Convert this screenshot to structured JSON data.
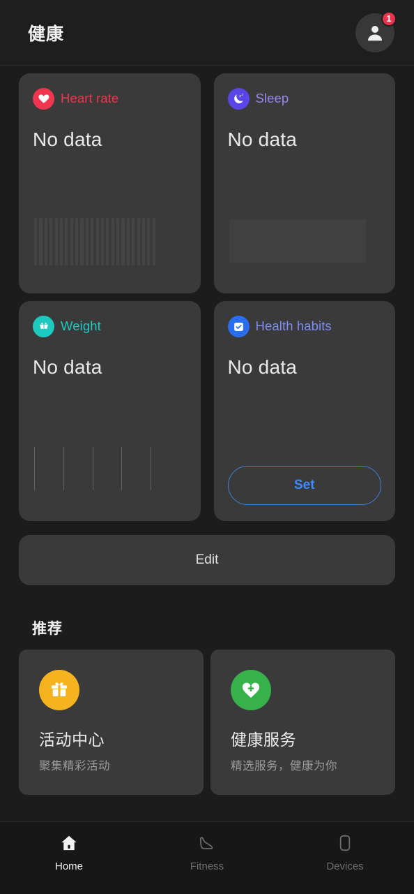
{
  "header": {
    "title": "健康",
    "avatar_icon": "person-icon",
    "badge_count": "1"
  },
  "metrics": [
    {
      "id": "heart-rate",
      "title": "Heart rate",
      "value": "No data",
      "icon": "heart-icon",
      "icon_bg": "#f0364f",
      "title_color": "#f0364f",
      "art": "bars"
    },
    {
      "id": "sleep",
      "title": "Sleep",
      "value": "No data",
      "icon": "moon-zzz-icon",
      "icon_bg": "#5a46e6",
      "title_color": "#9b87f0",
      "art": "block"
    },
    {
      "id": "weight",
      "title": "Weight",
      "value": "No data",
      "icon": "scale-icon",
      "icon_bg": "#1ecac0",
      "title_color": "#1ecac0",
      "art": "ticks"
    },
    {
      "id": "health-habits",
      "title": "Health habits",
      "value": "No data",
      "icon": "calendar-check-icon",
      "icon_bg": "#2a6ef0",
      "title_color": "#7e8ef5",
      "art": "set-button",
      "action_label": "Set"
    }
  ],
  "edit": {
    "label": "Edit"
  },
  "recommend": {
    "section_title": "推荐",
    "cards": [
      {
        "id": "activity-center",
        "title": "活动中心",
        "subtitle": "聚集精彩活动",
        "icon": "gift-icon",
        "icon_bg": "#f5b320"
      },
      {
        "id": "health-services",
        "title": "健康服务",
        "subtitle": "精选服务，健康为你",
        "icon": "heart-plus-icon",
        "icon_bg": "#37b24a"
      }
    ]
  },
  "bottom_nav": {
    "items": [
      {
        "id": "home",
        "label": "Home",
        "icon": "home-icon",
        "active": true
      },
      {
        "id": "fitness",
        "label": "Fitness",
        "icon": "shoe-icon",
        "active": false
      },
      {
        "id": "devices",
        "label": "Devices",
        "icon": "watch-icon",
        "active": false
      }
    ]
  },
  "colors": {
    "page_bg": "#1c1c1c",
    "card_bg": "#3a3a3a",
    "accent_blue": "#3d8bfd"
  }
}
